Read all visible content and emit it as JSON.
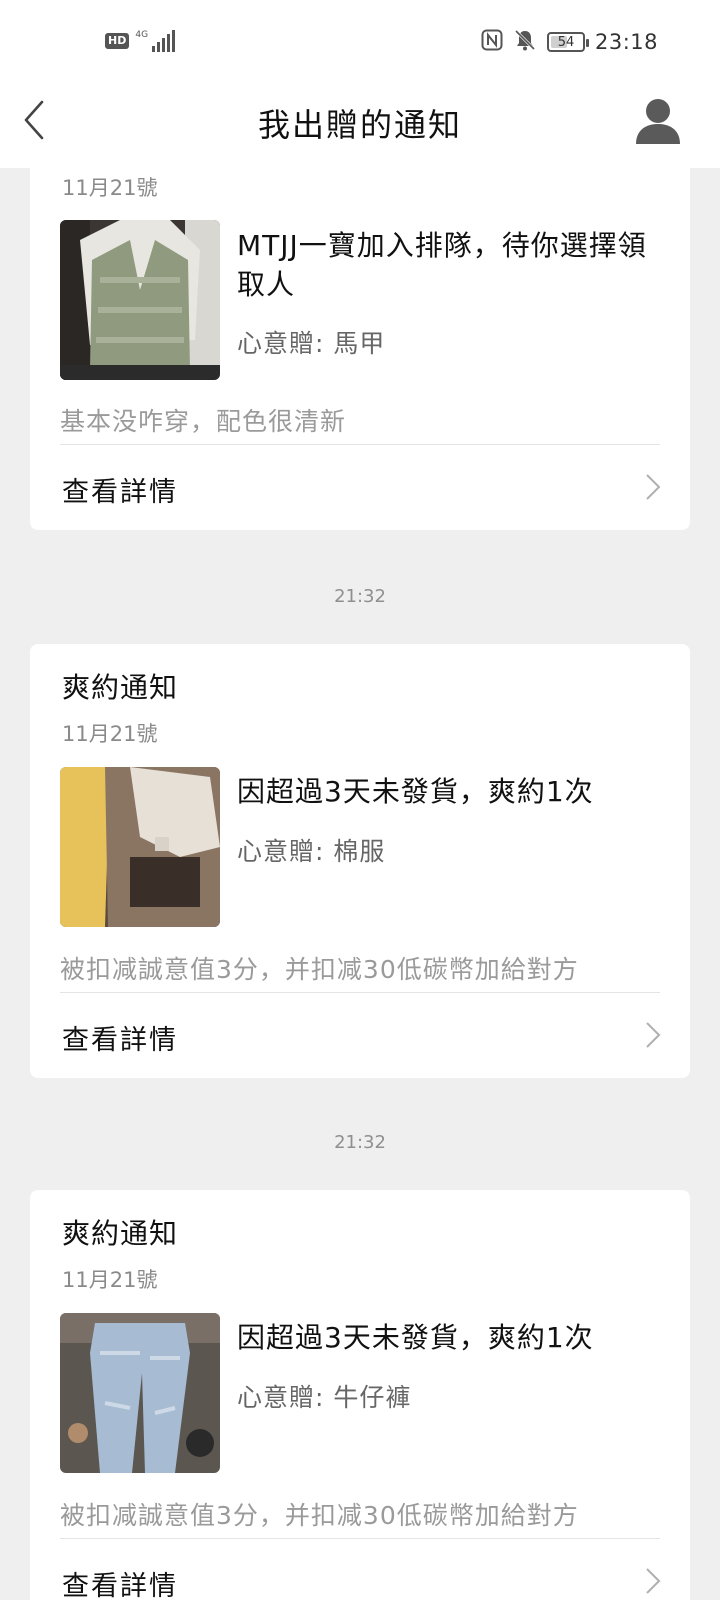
{
  "status_bar": {
    "hd": "HD",
    "network": "4G",
    "battery": "54",
    "battery_level_percent": 54,
    "time": "23:18"
  },
  "nav": {
    "title": "我出贈的通知",
    "back_icon": "chevron-left-icon",
    "profile_icon": "user-icon"
  },
  "cards": [
    {
      "title": "",
      "date": "11月21號",
      "message": "MTJJ一寶加入排隊，待你選擇領取人",
      "gift": "心意贈: 馬甲",
      "note": "基本没咋穿，配色很清新",
      "detail_label": "查看詳情"
    },
    {
      "title": "爽約通知",
      "date": "11月21號",
      "message": "因超過3天未發貨，爽約1次",
      "gift": "心意贈: 棉服",
      "note": "被扣减誠意值3分，并扣减30低碳幣加給對方",
      "detail_label": "查看詳情"
    },
    {
      "title": "爽約通知",
      "date": "11月21號",
      "message": "因超過3天未發貨，爽約1次",
      "gift": "心意贈: 牛仔褲",
      "note": "被扣减誠意值3分，并扣减30低碳幣加給對方",
      "detail_label": "查看詳情"
    }
  ],
  "timestamps": [
    "21:32",
    "21:32"
  ],
  "colors": {
    "background": "#efefef",
    "card": "#ffffff",
    "secondary_text": "#8a8a8a"
  }
}
